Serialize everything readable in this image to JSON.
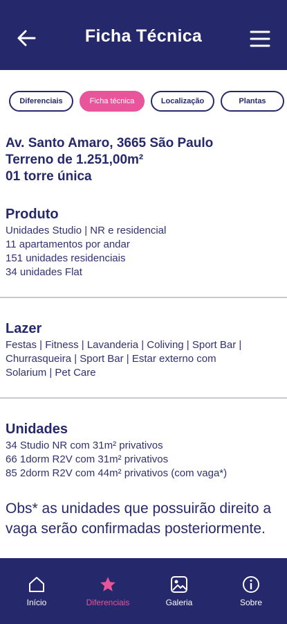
{
  "header": {
    "title": "Ficha Técnica",
    "back_icon": "arrow-left-icon",
    "menu_icon": "hamburger-menu-icon"
  },
  "tabs": [
    {
      "label": "Diferenciais",
      "active": false
    },
    {
      "label": "Ficha técnica",
      "active": true
    },
    {
      "label": "Localização",
      "active": false
    },
    {
      "label": "Plantas",
      "active": false
    }
  ],
  "address": {
    "line1": "Av. Santo Amaro, 3665 São Paulo",
    "line2": "Terreno de 1.251,00m²",
    "line3": "01 torre única"
  },
  "produto": {
    "title": "Produto",
    "lines": [
      "Unidades Studio | NR e residencial",
      "11 apartamentos por andar",
      "151 unidades residenciais",
      "34 unidades Flat"
    ]
  },
  "lazer": {
    "title": "Lazer",
    "lines": [
      "Festas | Fitness | Lavanderia | Coliving | Sport Bar |",
      "Churrasqueira | Sport Bar | Estar externo com",
      "Solarium | Pet Care"
    ]
  },
  "unidades": {
    "title": "Unidades",
    "lines": [
      "34 Studio NR com 31m² privativos",
      "66 1dorm R2V com 31m² privativos",
      "85 2dorm R2V com 44m² privativos (com vaga*)"
    ]
  },
  "obs": "Obs* as unidades que possuirão direito a vaga serão confirmadas posteriormente.",
  "bottom_nav": [
    {
      "label": "Início",
      "icon": "home-icon",
      "active": false
    },
    {
      "label": "Diferenciais",
      "icon": "star-icon",
      "active": true
    },
    {
      "label": "Galeria",
      "icon": "gallery-icon",
      "active": false
    },
    {
      "label": "Sobre",
      "icon": "info-icon",
      "active": false
    }
  ],
  "colors": {
    "navy": "#25286a",
    "accent": "#e8559a",
    "divider": "#c9c9cf"
  }
}
